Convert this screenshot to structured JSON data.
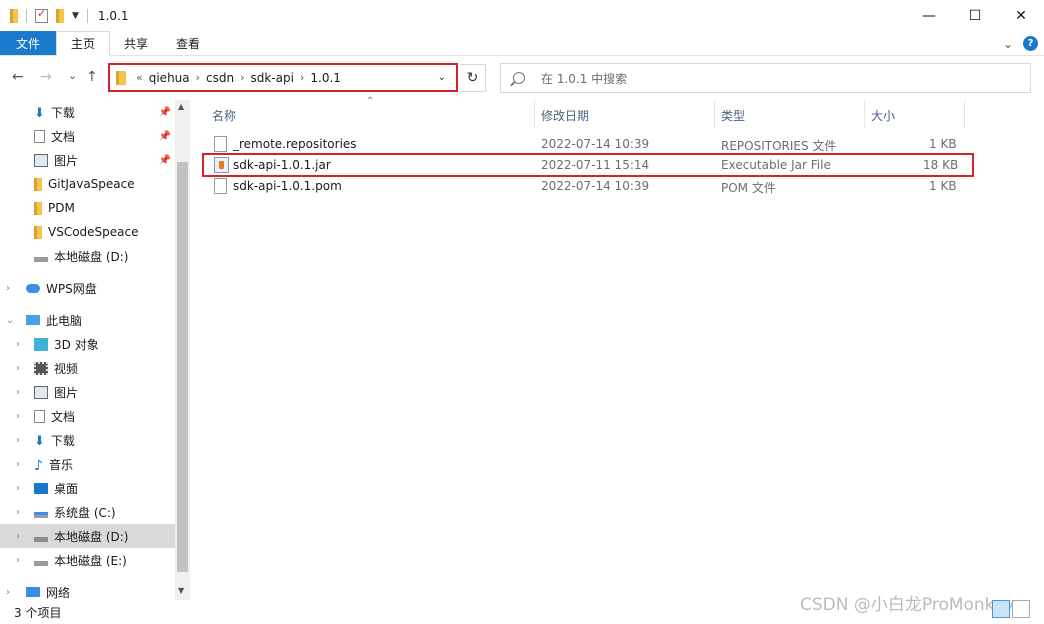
{
  "window": {
    "title": "1.0.1",
    "controls": {
      "minimize": "—",
      "maximize": "☐",
      "close": "✕"
    }
  },
  "ribbon": {
    "tabs": [
      "文件",
      "主页",
      "共享",
      "查看"
    ],
    "collapse": "⌄",
    "help": "?"
  },
  "nav": {
    "back": "←",
    "forward": "→",
    "recent": "⌄",
    "up": "↑"
  },
  "address": {
    "overflow": "«",
    "crumbs": [
      "qiehua",
      "csdn",
      "sdk-api",
      "1.0.1"
    ],
    "separator": "›",
    "dropdown": "⌄",
    "refresh": "↻"
  },
  "search": {
    "placeholder": "在 1.0.1 中搜索"
  },
  "sidebar": {
    "items": [
      {
        "label": "下载",
        "icon": "download-icon",
        "pinned": true
      },
      {
        "label": "文档",
        "icon": "document-icon",
        "pinned": true
      },
      {
        "label": "图片",
        "icon": "picture-icon",
        "pinned": true
      },
      {
        "label": "GitJavaSpeace",
        "icon": "folder-icon"
      },
      {
        "label": "PDM",
        "icon": "folder-icon"
      },
      {
        "label": "VSCodeSpeace",
        "icon": "folder-icon"
      },
      {
        "label": "本地磁盘 (D:)",
        "icon": "drive-icon"
      },
      {
        "label": "WPS网盘",
        "icon": "cloud-icon"
      },
      {
        "label": "此电脑",
        "icon": "computer-icon"
      },
      {
        "label": "3D 对象",
        "icon": "3d-objects-icon"
      },
      {
        "label": "视频",
        "icon": "video-icon"
      },
      {
        "label": "图片",
        "icon": "picture-icon"
      },
      {
        "label": "文档",
        "icon": "document-icon"
      },
      {
        "label": "下载",
        "icon": "download-icon"
      },
      {
        "label": "音乐",
        "icon": "music-icon"
      },
      {
        "label": "桌面",
        "icon": "desktop-icon"
      },
      {
        "label": "系统盘 (C:)",
        "icon": "system-drive-icon"
      },
      {
        "label": "本地磁盘 (D:)",
        "icon": "drive-icon",
        "selected": true
      },
      {
        "label": "本地磁盘 (E:)",
        "icon": "drive-icon"
      },
      {
        "label": "网络",
        "icon": "network-icon"
      }
    ]
  },
  "columns": [
    "名称",
    "修改日期",
    "类型",
    "大小"
  ],
  "files": [
    {
      "name": "_remote.repositories",
      "modified": "2022-07-14 10:39",
      "type": "REPOSITORIES 文件",
      "size": "1 KB",
      "icon": "file-icon"
    },
    {
      "name": "sdk-api-1.0.1.jar",
      "modified": "2022-07-11 15:14",
      "type": "Executable Jar File",
      "size": "18 KB",
      "icon": "jar-icon",
      "highlighted": true
    },
    {
      "name": "sdk-api-1.0.1.pom",
      "modified": "2022-07-14 10:39",
      "type": "POM 文件",
      "size": "1 KB",
      "icon": "file-icon"
    }
  ],
  "status": {
    "count": "3 个项目"
  },
  "watermark": "CSDN @小白龙ProMonkey",
  "colors": {
    "accent": "#1979ca",
    "highlight_border": "#d6222b",
    "selected_bg": "#d9d9d9"
  }
}
